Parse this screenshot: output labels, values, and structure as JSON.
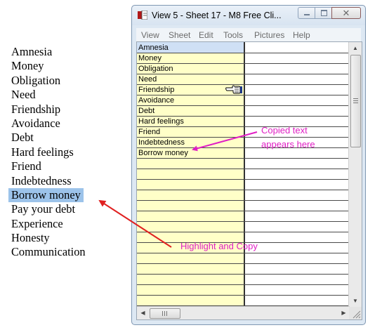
{
  "word_list": {
    "items": [
      "Amnesia",
      "Money",
      "Obligation",
      "Need",
      "Friendship",
      "Avoidance",
      "Debt",
      "Hard feelings",
      "Friend",
      "Indebtedness",
      "Borrow money",
      "Pay your debt",
      "Experience",
      "Honesty",
      "Communication"
    ],
    "highlighted": "Borrow money"
  },
  "window": {
    "title": "View 5  -   Sheet 17  -   M8 Free Cli...",
    "buttons": {
      "minimize": "minimize",
      "maximize": "maximize",
      "close": "✕"
    },
    "menu": [
      "View",
      "Sheet",
      "Edit",
      "Tools",
      "Pictures",
      "Help"
    ],
    "grid": {
      "column_a": [
        "Amnesia",
        "Money",
        "Obligation",
        "Need",
        "Friendship",
        "Avoidance",
        "Debt",
        "Hard feelings",
        "Friend",
        "Indebtedness",
        "Borrow money"
      ],
      "selected_cell": "Amnesia"
    }
  },
  "annotations": {
    "copied": [
      "Copied text",
      "appears here"
    ],
    "highlight": "Highlight and Copy",
    "arrow_color": "#e01fc4",
    "red_arrow_color": "#e02020"
  },
  "icons": [
    "app-icon",
    "hand-pointer-icon",
    "scroll-up-arrow-icon",
    "scroll-down-arrow-icon",
    "scroll-left-arrow-icon",
    "scroll-right-arrow-icon",
    "resize-grip-icon"
  ]
}
